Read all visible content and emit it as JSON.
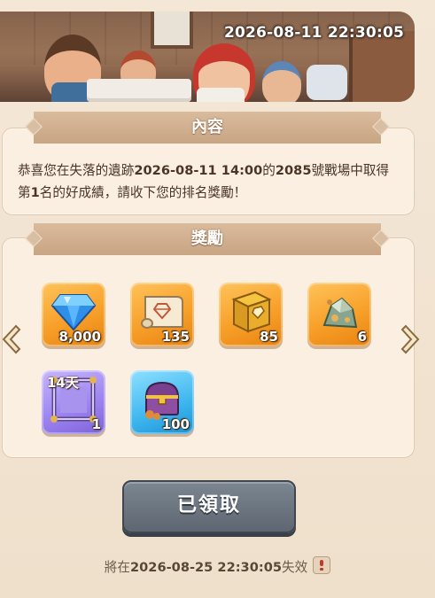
{
  "banner": {
    "timestamp": "2026-08-11 22:30:05"
  },
  "content": {
    "title": "內容",
    "message": {
      "p1": "恭喜您在失落的遺跡",
      "date": "2026-08-11 14:00",
      "p2": "的",
      "field": "2085",
      "p3": "號戰場中取得第",
      "rank": "1",
      "p4": "名的好成績，請收下您的排名獎勵！"
    }
  },
  "rewards": {
    "title": "獎勵",
    "items": [
      {
        "icon": "diamond-icon",
        "qty": "8,000",
        "color": "orange"
      },
      {
        "icon": "scroll-icon",
        "qty": "135",
        "color": "orange"
      },
      {
        "icon": "book-icon",
        "qty": "85",
        "color": "orange"
      },
      {
        "icon": "ore-icon",
        "qty": "6",
        "color": "orange"
      },
      {
        "icon": "frame-icon",
        "qty": "1",
        "days": "14天",
        "color": "purple"
      },
      {
        "icon": "chest-icon",
        "qty": "100",
        "color": "blue"
      }
    ]
  },
  "claim_button": {
    "label": "已領取"
  },
  "expire": {
    "prefix": "將在",
    "date": "2026-08-25 22:30:05",
    "suffix": "失效"
  },
  "colors": {
    "accent": "#c8a583",
    "button": "#6b747e",
    "background": "#f1e3d1"
  }
}
